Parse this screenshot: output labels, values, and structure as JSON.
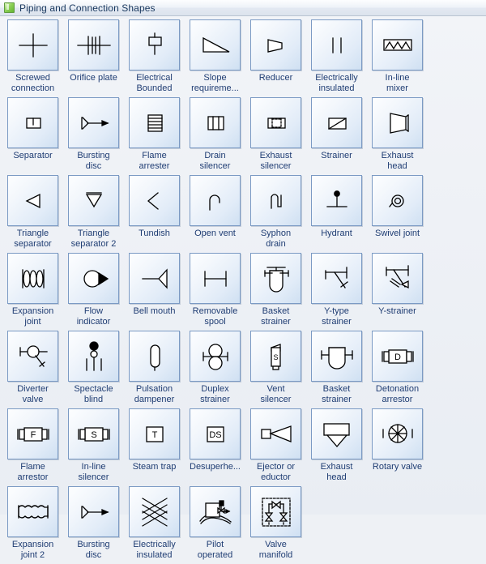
{
  "window": {
    "title": "Piping and Connection Shapes",
    "icon": "stencil-icon",
    "accent_color": "#1f3d73",
    "tile_border_color": "#7b9ac4",
    "title_icon_color": "#8ed157"
  },
  "stencil": {
    "columns": 8,
    "total_shapes": 55,
    "shapes": [
      {
        "id": "screwed-connection",
        "label_lines": [
          "Screwed",
          "connection"
        ],
        "glyph": "cross"
      },
      {
        "id": "orifice-plate",
        "label_lines": [
          "Orifice plate"
        ],
        "glyph": "orifice-plate"
      },
      {
        "id": "electrical-bounded",
        "label_lines": [
          "Electrical",
          "Bounded"
        ],
        "glyph": "electrical-bounded"
      },
      {
        "id": "slope-requirement",
        "label_lines": [
          "Slope",
          "requireme..."
        ],
        "glyph": "slope"
      },
      {
        "id": "reducer",
        "label_lines": [
          "Reducer"
        ],
        "glyph": "reducer"
      },
      {
        "id": "electrically-insulated",
        "label_lines": [
          "Electrically",
          "insulated"
        ],
        "glyph": "two-bars"
      },
      {
        "id": "in-line-mixer",
        "label_lines": [
          "In-line",
          "mixer"
        ],
        "glyph": "inline-mixer"
      },
      {
        "id": "separator",
        "label_lines": [
          "Separator"
        ],
        "glyph": "separator"
      },
      {
        "id": "bursting-disc",
        "label_lines": [
          "Bursting",
          "disc"
        ],
        "glyph": "bursting-disc"
      },
      {
        "id": "flame-arrester",
        "label_lines": [
          "Flame",
          "arrester"
        ],
        "glyph": "flame-arrester"
      },
      {
        "id": "drain-silencer",
        "label_lines": [
          "Drain",
          "silencer"
        ],
        "glyph": "drain-silencer"
      },
      {
        "id": "exhaust-silencer",
        "label_lines": [
          "Exhaust",
          "silencer"
        ],
        "glyph": "exhaust-silencer"
      },
      {
        "id": "strainer",
        "label_lines": [
          "Strainer"
        ],
        "glyph": "strainer"
      },
      {
        "id": "exhaust-head",
        "label_lines": [
          "Exhaust",
          "head"
        ],
        "glyph": "exhaust-head-cone"
      },
      {
        "id": "triangle-separator",
        "label_lines": [
          "Triangle",
          "separator"
        ],
        "glyph": "triangle-left"
      },
      {
        "id": "triangle-separator-2",
        "label_lines": [
          "Triangle",
          "separator 2"
        ],
        "glyph": "triangle-down"
      },
      {
        "id": "tundish",
        "label_lines": [
          "Tundish"
        ],
        "glyph": "chevron-left"
      },
      {
        "id": "open-vent",
        "label_lines": [
          "Open vent"
        ],
        "glyph": "open-vent"
      },
      {
        "id": "syphon-drain",
        "label_lines": [
          "Syphon",
          "drain"
        ],
        "glyph": "syphon-drain"
      },
      {
        "id": "hydrant",
        "label_lines": [
          "Hydrant"
        ],
        "glyph": "hydrant"
      },
      {
        "id": "swivel-joint",
        "label_lines": [
          "Swivel joint"
        ],
        "glyph": "swivel-joint"
      },
      {
        "id": "expansion-joint",
        "label_lines": [
          "Expansion",
          "joint"
        ],
        "glyph": "expansion-joint"
      },
      {
        "id": "flow-indicator",
        "label_lines": [
          "Flow",
          "indicator"
        ],
        "glyph": "flow-indicator"
      },
      {
        "id": "bell-mouth",
        "label_lines": [
          "Bell mouth"
        ],
        "glyph": "bell-mouth"
      },
      {
        "id": "removable-spool",
        "label_lines": [
          "Removable",
          "spool"
        ],
        "glyph": "removable-spool"
      },
      {
        "id": "basket-strainer",
        "label_lines": [
          "Basket",
          "strainer"
        ],
        "glyph": "basket-strainer-1"
      },
      {
        "id": "y-type-strainer",
        "label_lines": [
          "Y-type",
          "strainer"
        ],
        "glyph": "y-type-strainer"
      },
      {
        "id": "y-strainer",
        "label_lines": [
          "Y-strainer"
        ],
        "glyph": "y-strainer"
      },
      {
        "id": "diverter-valve",
        "label_lines": [
          "Diverter",
          "valve"
        ],
        "glyph": "diverter-valve"
      },
      {
        "id": "spectacle-blind",
        "label_lines": [
          "Spectacle",
          "blind"
        ],
        "glyph": "spectacle-blind"
      },
      {
        "id": "pulsation-dampener",
        "label_lines": [
          "Pulsation",
          "dampener"
        ],
        "glyph": "pulsation-dampener"
      },
      {
        "id": "duplex-strainer",
        "label_lines": [
          "Duplex",
          "strainer"
        ],
        "glyph": "duplex-strainer"
      },
      {
        "id": "vent-silencer",
        "label_lines": [
          "Vent",
          "silencer"
        ],
        "glyph": "vent-silencer",
        "text": "S"
      },
      {
        "id": "basket-strainer-2",
        "label_lines": [
          "Basket",
          "strainer"
        ],
        "glyph": "basket-strainer-2"
      },
      {
        "id": "detonation-arrestor",
        "label_lines": [
          "Detonation",
          "arrestor"
        ],
        "glyph": "lettered-inline",
        "text": "D"
      },
      {
        "id": "flame-arrestor",
        "label_lines": [
          "Flame",
          "arrestor"
        ],
        "glyph": "lettered-inline",
        "text": "F"
      },
      {
        "id": "in-line-silencer",
        "label_lines": [
          "In-line",
          "silencer"
        ],
        "glyph": "lettered-inline",
        "text": "S"
      },
      {
        "id": "steam-trap",
        "label_lines": [
          "Steam trap"
        ],
        "glyph": "lettered-box",
        "text": "T"
      },
      {
        "id": "desuperheater",
        "label_lines": [
          "Desuperhe..."
        ],
        "glyph": "lettered-box",
        "text": "DS"
      },
      {
        "id": "ejector-or-eductor",
        "label_lines": [
          "Ejector or",
          "eductor"
        ],
        "glyph": "ejector"
      },
      {
        "id": "exhaust-head-2",
        "label_lines": [
          "Exhaust",
          "head"
        ],
        "glyph": "exhaust-head-box"
      },
      {
        "id": "rotary-valve",
        "label_lines": [
          "Rotary valve"
        ],
        "glyph": "rotary-valve"
      },
      {
        "id": "expansion-joint-2",
        "label_lines": [
          "Expansion",
          "joint 2"
        ],
        "glyph": "expansion-joint-2"
      },
      {
        "id": "bursting-disc-2",
        "label_lines": [
          "Bursting",
          "disc"
        ],
        "glyph": "bursting-disc"
      },
      {
        "id": "electrically-insulated-2",
        "label_lines": [
          "Electrically",
          "insulated"
        ],
        "glyph": "crosshatch"
      },
      {
        "id": "pilot-operated",
        "label_lines": [
          "Pilot",
          "operated"
        ],
        "glyph": "pilot-operated"
      },
      {
        "id": "valve-manifold",
        "label_lines": [
          "Valve",
          "manifold"
        ],
        "glyph": "valve-manifold"
      }
    ]
  }
}
